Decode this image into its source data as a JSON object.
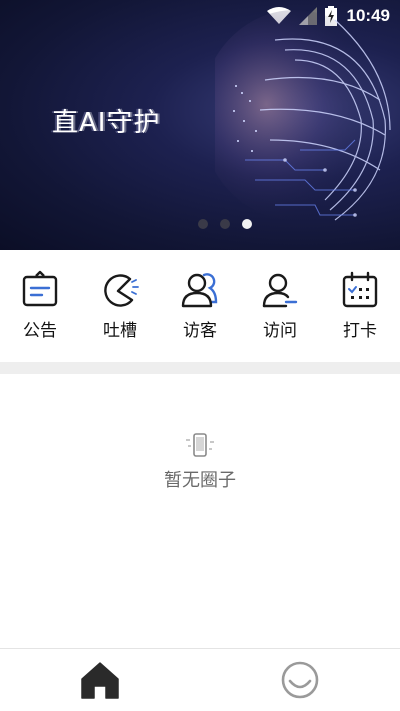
{
  "status_bar": {
    "time": "10:49",
    "icons": [
      "wifi-icon",
      "signal-icon",
      "battery-charging-icon"
    ]
  },
  "banner": {
    "title": "直AI守护",
    "dot_count": 3,
    "active_dot": 2
  },
  "actions": [
    {
      "label": "公告",
      "icon": "announcement-icon"
    },
    {
      "label": "吐槽",
      "icon": "pacman-complaint-icon"
    },
    {
      "label": "访客",
      "icon": "visitors-icon"
    },
    {
      "label": "访问",
      "icon": "visit-icon"
    },
    {
      "label": "打卡",
      "icon": "calendar-checkin-icon"
    }
  ],
  "empty_state": {
    "text": "暂无圈子",
    "icon": "phone-icon"
  },
  "bottom_nav": [
    {
      "name": "home",
      "icon": "home-icon",
      "active": true
    },
    {
      "name": "profile",
      "icon": "smile-icon",
      "active": false
    }
  ],
  "colors": {
    "accent": "#3b6fd4",
    "icon_dark": "#1a1a1a",
    "band": "#eeeeee"
  }
}
